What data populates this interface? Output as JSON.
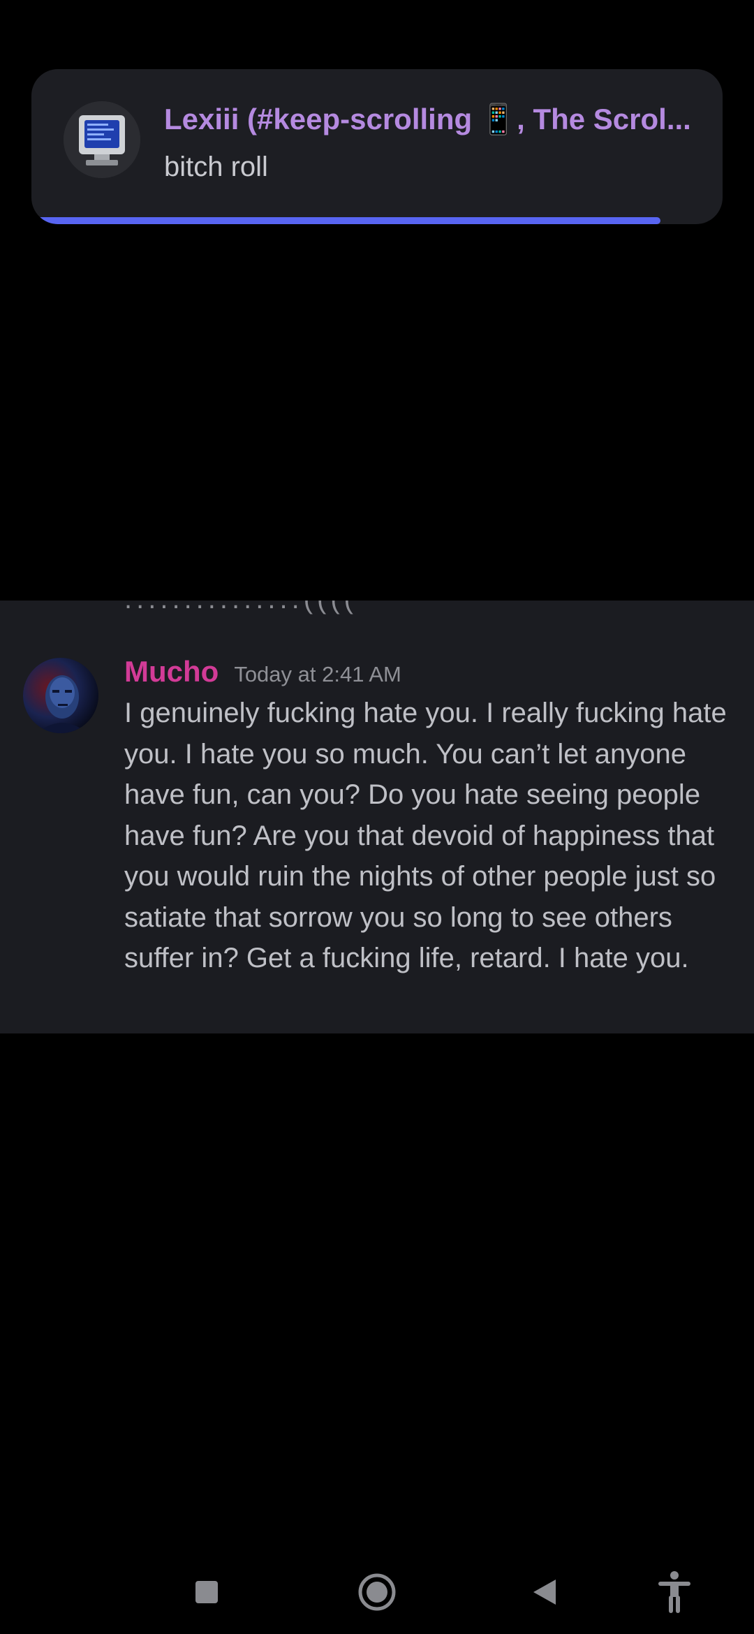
{
  "notification": {
    "title": "Lexiii (#keep-scrolling 📱, The Scrol...",
    "body": "bitch roll",
    "progress": 0.91,
    "accent_color": "#5865f2",
    "avatar_icon": "retro-computer-icon"
  },
  "message": {
    "previous_fragment": "...............((((",
    "author": "Mucho",
    "author_color": "#d23b97",
    "timestamp": "Today at 2:41 AM",
    "text": "I genuinely fucking hate you. I really fucking hate you. I hate you so much. You can’t let anyone have fun, can you? Do you hate seeing people have fun? Are you that devoid of happiness that you would ruin the nights of other people just so satiate that sorrow you so long to see others suffer in? Get a fucking life, retard. I hate you.",
    "avatar_icon": "user-photo-icon"
  },
  "navbar": {
    "buttons": [
      "recents-icon",
      "home-icon",
      "back-icon",
      "accessibility-icon"
    ]
  }
}
